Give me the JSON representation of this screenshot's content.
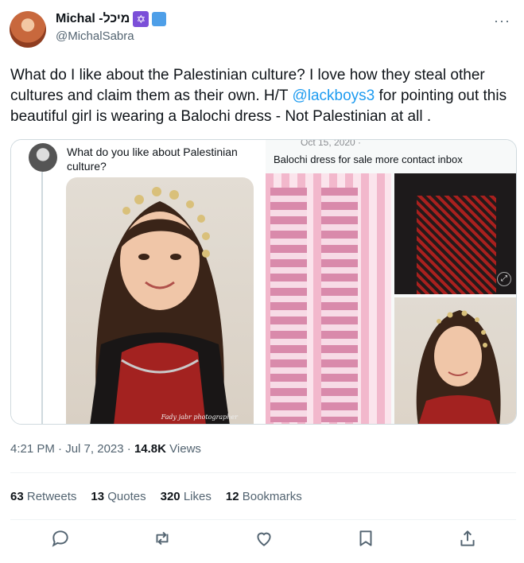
{
  "author": {
    "name": "Michal -מיכל",
    "handle": "@MichalSabra",
    "badges": [
      "star-of-david-icon",
      "verified-icon"
    ]
  },
  "tweet": {
    "text_before": "What do I like about the Palestinian culture? I love how they steal other cultures and claim them as their own. H/T ",
    "mention": "@lackboys3",
    "text_after": " for pointing out this beautiful girl is wearing a Balochi dress - Not Palestinian at all ."
  },
  "media": {
    "quote_text": "What do you like about Palestinian culture?",
    "photo_credit": "Fady jabr photographer",
    "post_date": "Oct 15, 2020 ·",
    "post_caption": "Balochi dress for sale more contact inbox"
  },
  "meta": {
    "time": "4:21 PM",
    "separator": " · ",
    "date": "Jul 7, 2023",
    "views": "14.8K",
    "views_label": "Views"
  },
  "stats": {
    "retweets": "63",
    "retweets_label": "Retweets",
    "quotes": "13",
    "quotes_label": "Quotes",
    "likes": "320",
    "likes_label": "Likes",
    "bookmarks": "12",
    "bookmarks_label": "Bookmarks"
  },
  "actions": [
    "reply-icon",
    "retweet-icon",
    "like-icon",
    "bookmark-icon",
    "share-icon"
  ],
  "colors": {
    "accent": "#1d9bf0",
    "secondary_text": "#536471",
    "primary_text": "#0f1419",
    "star_badge": "#7b4fd8",
    "verified_badge": "#4e9fe8"
  }
}
